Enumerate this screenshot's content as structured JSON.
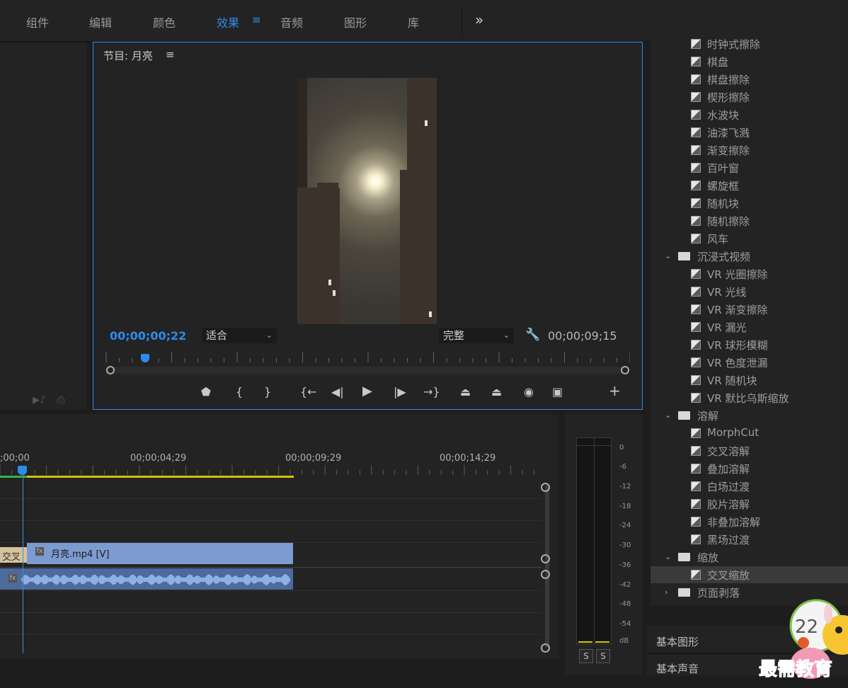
{
  "menu": {
    "items": [
      {
        "label": "组件",
        "active": false
      },
      {
        "label": "编辑",
        "active": false
      },
      {
        "label": "颜色",
        "active": false
      },
      {
        "label": "效果",
        "active": true
      },
      {
        "label": "音频",
        "active": false
      },
      {
        "label": "图形",
        "active": false
      },
      {
        "label": "库",
        "active": false
      }
    ],
    "overflow_icon": "double-chevron-right",
    "menu_icon": "hamburger"
  },
  "program_monitor": {
    "title": "节目: 月亮",
    "current_timecode": "00;00;00;22",
    "fit_select": "适合",
    "quality_select": "完整",
    "duration_timecode": "00;00;09;15",
    "playhead_position_fraction": 0.07
  },
  "transport_icons": [
    "marker-icon",
    "mark-in-icon",
    "mark-out-icon",
    "go-to-in-icon",
    "step-back-icon",
    "play-icon",
    "step-forward-icon",
    "go-to-out-icon",
    "lift-icon",
    "extract-icon",
    "camera-icon",
    "comparison-view-icon",
    "add-button-icon"
  ],
  "timeline": {
    "timecodes": [
      ";00;00",
      "00;00;04;29",
      "00;00;09;29",
      "00;00;14;29"
    ],
    "transition_label": "交叉",
    "video_clip_label": "月亮.mp4 [V]",
    "fx_badge": "fx"
  },
  "audio_meter": {
    "db_labels": [
      "0",
      "-6",
      "-12",
      "-18",
      "-24",
      "-30",
      "-36",
      "-42",
      "-48",
      "-54",
      "dB"
    ],
    "solo_labels": [
      "S",
      "S"
    ]
  },
  "effects": {
    "rows": [
      {
        "type": "effect",
        "label": "时钟式擦除"
      },
      {
        "type": "effect",
        "label": "棋盘"
      },
      {
        "type": "effect",
        "label": "棋盘擦除"
      },
      {
        "type": "effect",
        "label": "楔形擦除"
      },
      {
        "type": "effect",
        "label": "水波块"
      },
      {
        "type": "effect",
        "label": "油漆飞溅"
      },
      {
        "type": "effect",
        "label": "渐变擦除"
      },
      {
        "type": "effect",
        "label": "百叶窗"
      },
      {
        "type": "effect",
        "label": "螺旋框"
      },
      {
        "type": "effect",
        "label": "随机块"
      },
      {
        "type": "effect",
        "label": "随机擦除"
      },
      {
        "type": "effect",
        "label": "风车"
      },
      {
        "type": "folder",
        "label": "沉浸式视频",
        "expanded": true
      },
      {
        "type": "effect",
        "label": "VR 光圈擦除"
      },
      {
        "type": "effect",
        "label": "VR 光线"
      },
      {
        "type": "effect",
        "label": "VR 渐变擦除"
      },
      {
        "type": "effect",
        "label": "VR 漏光"
      },
      {
        "type": "effect",
        "label": "VR 球形模糊"
      },
      {
        "type": "effect",
        "label": "VR 色度泄漏"
      },
      {
        "type": "effect",
        "label": "VR 随机块"
      },
      {
        "type": "effect",
        "label": "VR 默比乌斯缩放"
      },
      {
        "type": "folder",
        "label": "溶解",
        "expanded": true
      },
      {
        "type": "effect",
        "label": "MorphCut"
      },
      {
        "type": "effect",
        "label": "交叉溶解"
      },
      {
        "type": "effect",
        "label": "叠加溶解"
      },
      {
        "type": "effect",
        "label": "白场过渡"
      },
      {
        "type": "effect",
        "label": "胶片溶解"
      },
      {
        "type": "effect",
        "label": "非叠加溶解"
      },
      {
        "type": "effect",
        "label": "黑场过渡"
      },
      {
        "type": "folder",
        "label": "缩放",
        "expanded": true
      },
      {
        "type": "effect",
        "label": "交叉缩放",
        "selected": true
      },
      {
        "type": "folder",
        "label": "页面剥落",
        "expanded": false
      }
    ]
  },
  "bottom_panels": {
    "essential_graphics": "基本图形",
    "essential_sound": "基本声音"
  },
  "watermark": {
    "text": "最需教育",
    "badge_number": "22"
  },
  "colors": {
    "accent": "#2d8ceb",
    "panel": "#232323",
    "video_clip": "#7c9bd1",
    "audio_clip": "#4c6a9c",
    "work_area": "#d9c100"
  }
}
